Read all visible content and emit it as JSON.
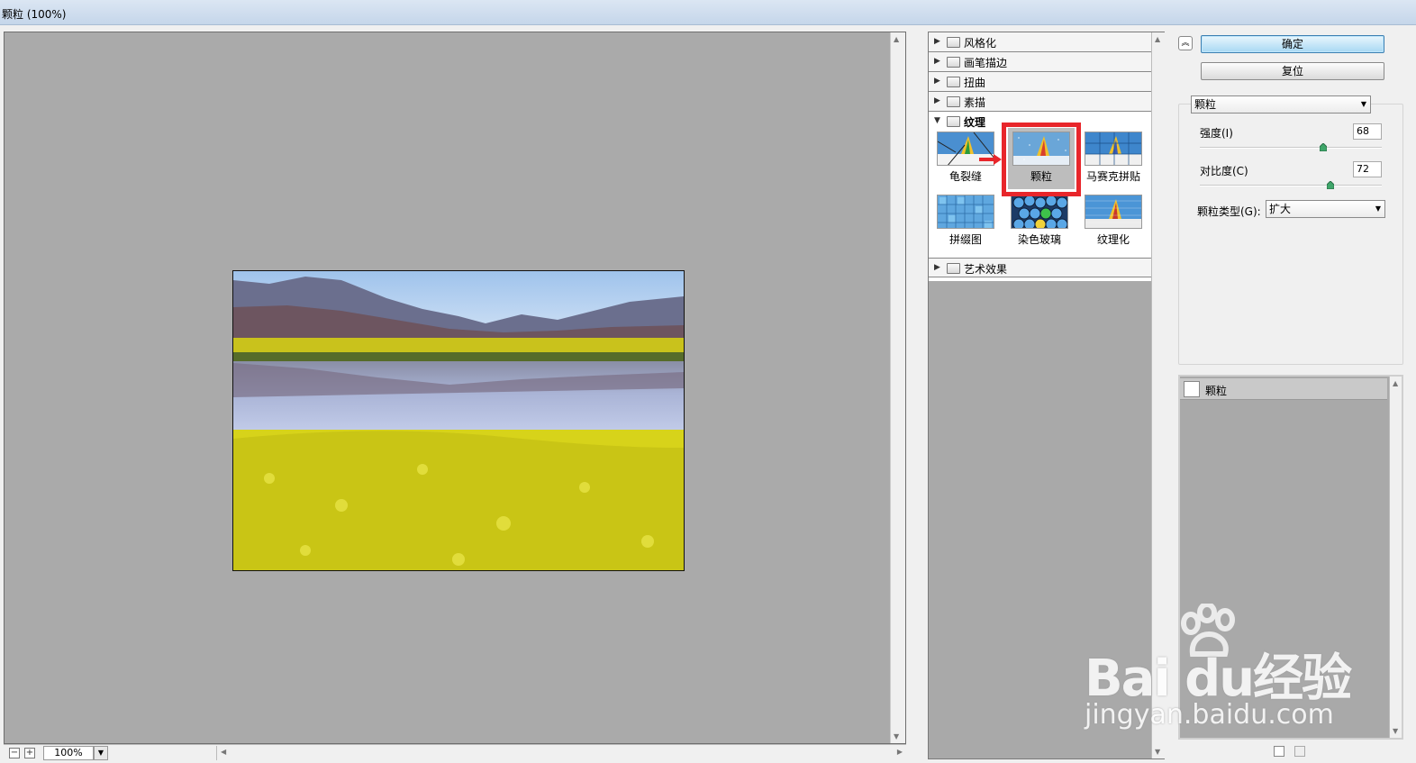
{
  "window": {
    "title": "颗粒 (100%)"
  },
  "preview": {
    "zoom": "100%",
    "zoom_out": "−",
    "zoom_in": "+"
  },
  "gallery": {
    "categories": [
      {
        "label": "风格化",
        "expanded": false
      },
      {
        "label": "画笔描边",
        "expanded": false
      },
      {
        "label": "扭曲",
        "expanded": false
      },
      {
        "label": "素描",
        "expanded": false
      },
      {
        "label": "纹理",
        "expanded": true
      },
      {
        "label": "艺术效果",
        "expanded": false
      }
    ],
    "texture_filters": [
      {
        "label": "龟裂缝"
      },
      {
        "label": "颗粒",
        "selected": true
      },
      {
        "label": "马赛克拼贴"
      },
      {
        "label": "拼缀图"
      },
      {
        "label": "染色玻璃"
      },
      {
        "label": "纹理化"
      }
    ]
  },
  "panel": {
    "ok_label": "确定",
    "reset_label": "复位",
    "filter_select": "颗粒",
    "intensity_label": "强度(I)",
    "intensity_value": "68",
    "intensity_fraction": 0.68,
    "contrast_label": "对比度(C)",
    "contrast_value": "72",
    "contrast_fraction": 0.72,
    "grain_type_label": "颗粒类型(G):",
    "grain_type_value": "扩大",
    "layer_label": "颗粒"
  },
  "watermark": {
    "main": "Bai du经验",
    "sub": "jingyan.baidu.com"
  },
  "colors": {
    "accent_red": "#e8262b",
    "ok_button": "#a7d8f3",
    "canvas_gray": "#aaaaaa"
  },
  "icons": [
    "folder-icon",
    "triangle-right-icon",
    "triangle-down-icon",
    "chevron-up-icon",
    "new-layer-icon",
    "trash-icon"
  ]
}
